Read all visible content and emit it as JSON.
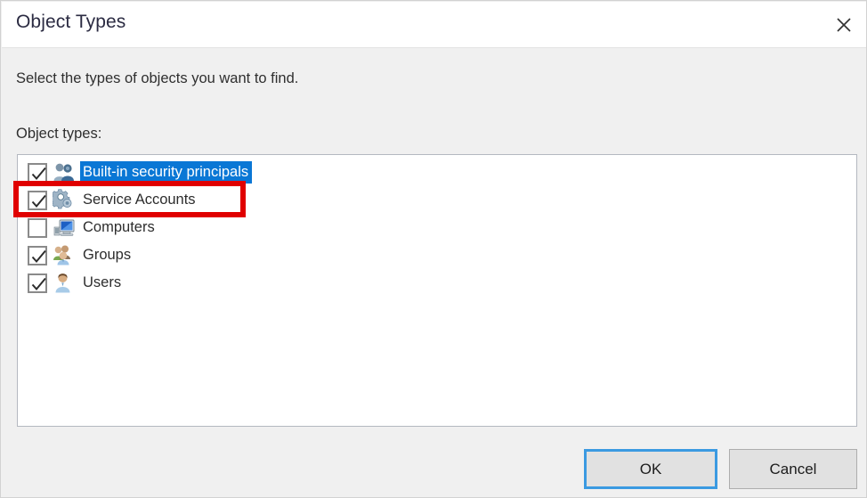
{
  "dialog": {
    "title": "Object Types",
    "close_icon": "close-icon",
    "instruction": "Select the types of objects you want to find.",
    "field_label": "Object types:"
  },
  "object_types": {
    "items": [
      {
        "label": "Built-in security principals",
        "checked": true,
        "selected": true,
        "icon": "builtin-security-principals-icon"
      },
      {
        "label": "Service Accounts",
        "checked": true,
        "selected": false,
        "icon": "service-accounts-gear-icon",
        "annotated": true
      },
      {
        "label": "Computers",
        "checked": false,
        "selected": false,
        "icon": "computer-icon"
      },
      {
        "label": "Groups",
        "checked": true,
        "selected": false,
        "icon": "groups-icon"
      },
      {
        "label": "Users",
        "checked": true,
        "selected": false,
        "icon": "user-icon"
      }
    ]
  },
  "buttons": {
    "ok": "OK",
    "cancel": "Cancel"
  },
  "colors": {
    "selection_blue": "#0a77d5",
    "annotation_red": "#e00000",
    "dialog_background": "#f0f0f0",
    "focus_border": "#3b9ae1"
  }
}
